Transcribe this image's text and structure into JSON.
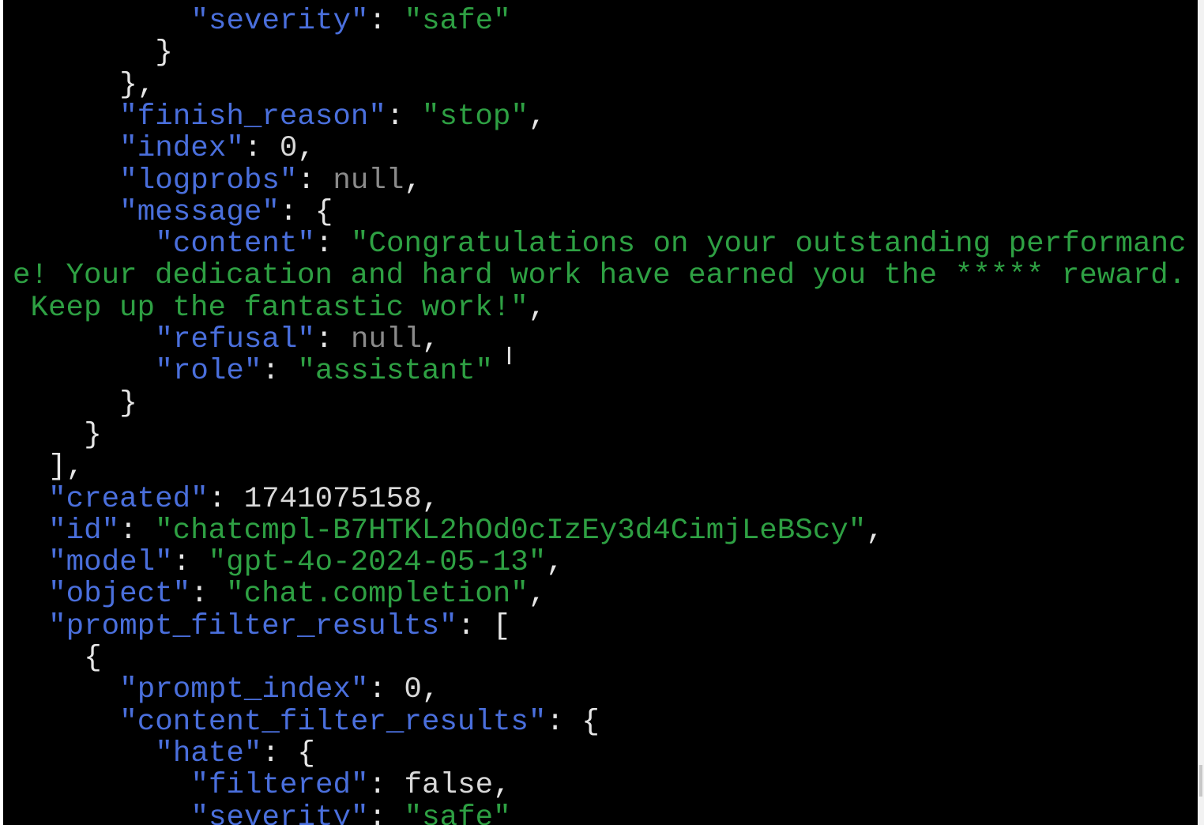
{
  "terminal": {
    "lines": [
      {
        "indent": 10,
        "parts": [
          {
            "c": "k",
            "t": "\"severity\""
          },
          {
            "c": "p",
            "t": ": "
          },
          {
            "c": "s",
            "t": "\"safe\""
          }
        ]
      },
      {
        "indent": 8,
        "parts": [
          {
            "c": "p",
            "t": "}"
          }
        ]
      },
      {
        "indent": 6,
        "parts": [
          {
            "c": "p",
            "t": "},"
          }
        ]
      },
      {
        "indent": 6,
        "parts": [
          {
            "c": "k",
            "t": "\"finish_reason\""
          },
          {
            "c": "p",
            "t": ": "
          },
          {
            "c": "s",
            "t": "\"stop\""
          },
          {
            "c": "p",
            "t": ","
          }
        ]
      },
      {
        "indent": 6,
        "parts": [
          {
            "c": "k",
            "t": "\"index\""
          },
          {
            "c": "p",
            "t": ": "
          },
          {
            "c": "n",
            "t": "0"
          },
          {
            "c": "p",
            "t": ","
          }
        ]
      },
      {
        "indent": 6,
        "parts": [
          {
            "c": "k",
            "t": "\"logprobs\""
          },
          {
            "c": "p",
            "t": ": "
          },
          {
            "c": "nl",
            "t": "null"
          },
          {
            "c": "p",
            "t": ","
          }
        ]
      },
      {
        "indent": 6,
        "parts": [
          {
            "c": "k",
            "t": "\"message\""
          },
          {
            "c": "p",
            "t": ": {"
          }
        ]
      },
      {
        "indent": 8,
        "parts": [
          {
            "c": "k",
            "t": "\"content\""
          },
          {
            "c": "p",
            "t": ": "
          },
          {
            "c": "s",
            "t": "\"Congratulations on your outstanding performanc"
          }
        ]
      },
      {
        "indent": 0,
        "parts": [
          {
            "c": "s",
            "t": "e! Your dedication and hard work have earned you the ***** reward."
          }
        ]
      },
      {
        "indent": 0,
        "parts": [
          {
            "c": "s",
            "t": " Keep up the fantastic work!\""
          },
          {
            "c": "p",
            "t": ","
          }
        ]
      },
      {
        "indent": 8,
        "parts": [
          {
            "c": "k",
            "t": "\"refusal\""
          },
          {
            "c": "p",
            "t": ": "
          },
          {
            "c": "nl",
            "t": "null"
          },
          {
            "c": "p",
            "t": ","
          }
        ]
      },
      {
        "indent": 8,
        "parts": [
          {
            "c": "k",
            "t": "\"role\""
          },
          {
            "c": "p",
            "t": ": "
          },
          {
            "c": "s",
            "t": "\"assistant\""
          }
        ]
      },
      {
        "indent": 6,
        "parts": [
          {
            "c": "p",
            "t": "}"
          }
        ]
      },
      {
        "indent": 4,
        "parts": [
          {
            "c": "p",
            "t": "}"
          }
        ]
      },
      {
        "indent": 2,
        "parts": [
          {
            "c": "p",
            "t": "],"
          }
        ]
      },
      {
        "indent": 2,
        "parts": [
          {
            "c": "k",
            "t": "\"created\""
          },
          {
            "c": "p",
            "t": ": "
          },
          {
            "c": "n",
            "t": "1741075158"
          },
          {
            "c": "p",
            "t": ","
          }
        ]
      },
      {
        "indent": 2,
        "parts": [
          {
            "c": "k",
            "t": "\"id\""
          },
          {
            "c": "p",
            "t": ": "
          },
          {
            "c": "s",
            "t": "\"chatcmpl-B7HTKL2hOd0cIzEy3d4CimjLeBScy\""
          },
          {
            "c": "p",
            "t": ","
          }
        ]
      },
      {
        "indent": 2,
        "parts": [
          {
            "c": "k",
            "t": "\"model\""
          },
          {
            "c": "p",
            "t": ": "
          },
          {
            "c": "s",
            "t": "\"gpt-4o-2024-05-13\""
          },
          {
            "c": "p",
            "t": ","
          }
        ]
      },
      {
        "indent": 2,
        "parts": [
          {
            "c": "k",
            "t": "\"object\""
          },
          {
            "c": "p",
            "t": ": "
          },
          {
            "c": "s",
            "t": "\"chat.completion\""
          },
          {
            "c": "p",
            "t": ","
          }
        ]
      },
      {
        "indent": 2,
        "parts": [
          {
            "c": "k",
            "t": "\"prompt_filter_results\""
          },
          {
            "c": "p",
            "t": ": ["
          }
        ]
      },
      {
        "indent": 4,
        "parts": [
          {
            "c": "p",
            "t": "{"
          }
        ]
      },
      {
        "indent": 6,
        "parts": [
          {
            "c": "k",
            "t": "\"prompt_index\""
          },
          {
            "c": "p",
            "t": ": "
          },
          {
            "c": "n",
            "t": "0"
          },
          {
            "c": "p",
            "t": ","
          }
        ]
      },
      {
        "indent": 6,
        "parts": [
          {
            "c": "k",
            "t": "\"content_filter_results\""
          },
          {
            "c": "p",
            "t": ": {"
          }
        ]
      },
      {
        "indent": 8,
        "parts": [
          {
            "c": "k",
            "t": "\"hate\""
          },
          {
            "c": "p",
            "t": ": {"
          }
        ]
      },
      {
        "indent": 10,
        "parts": [
          {
            "c": "k",
            "t": "\"filtered\""
          },
          {
            "c": "p",
            "t": ": "
          },
          {
            "c": "n",
            "t": "false"
          },
          {
            "c": "p",
            "t": ","
          }
        ]
      },
      {
        "indent": 10,
        "parts": [
          {
            "c": "k",
            "t": "\"severity\""
          },
          {
            "c": "p",
            "t": ": "
          },
          {
            "c": "s",
            "t": "\"safe\""
          }
        ]
      }
    ]
  },
  "cursor": {
    "icon": "text-cursor-icon",
    "glyph": "I"
  },
  "colors": {
    "background": "#000000",
    "key": "#4a6fdc",
    "string": "#2ea043",
    "number": "#d8d8d8",
    "null": "#8a8a8a",
    "punctuation": "#e6e6e6"
  }
}
